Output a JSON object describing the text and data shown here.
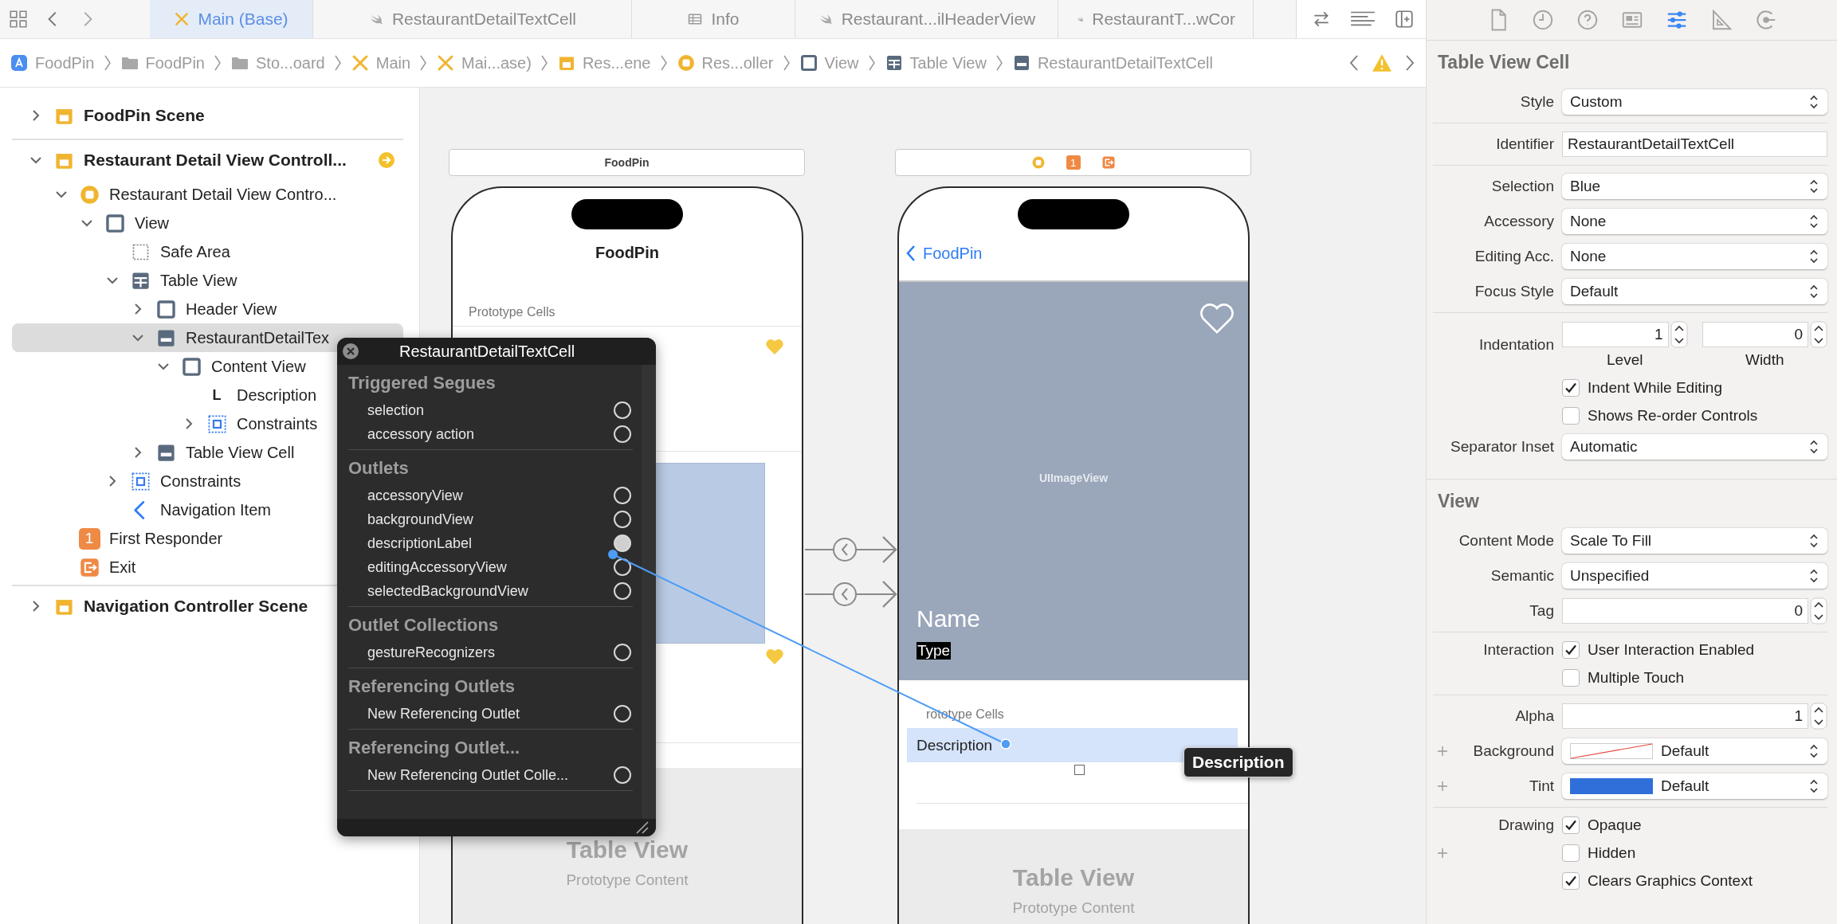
{
  "tab_bar": {
    "tabs": [
      {
        "label": "Main (Base)",
        "kind": "storyboard",
        "selected": true
      },
      {
        "label": "RestaurantDetailTextCell",
        "kind": "swift",
        "selected": false
      },
      {
        "label": "Info",
        "kind": "plist",
        "selected": false
      },
      {
        "label": "Restaurant...ilHeaderView",
        "kind": "swift",
        "selected": false
      },
      {
        "label": "RestaurantT...wCor",
        "kind": "swift",
        "selected": false
      }
    ]
  },
  "jump_bar": [
    {
      "label": "FoodPin",
      "kind": "app"
    },
    {
      "label": "FoodPin",
      "kind": "folder"
    },
    {
      "label": "Sto...oard",
      "kind": "folder"
    },
    {
      "label": "Main",
      "kind": "storyboard"
    },
    {
      "label": "Mai...ase)",
      "kind": "storyboard"
    },
    {
      "label": "Res...ene",
      "kind": "scene"
    },
    {
      "label": "Res...oller",
      "kind": "controller"
    },
    {
      "label": "View",
      "kind": "view"
    },
    {
      "label": "Table View",
      "kind": "table"
    },
    {
      "label": "RestaurantDetailTextCell",
      "kind": "cell"
    }
  ],
  "outline": {
    "scenes": [
      {
        "label": "FoodPin Scene",
        "expanded": false,
        "selected": false,
        "entry_arrow": false
      },
      {
        "label": "Restaurant Detail View Controll...",
        "expanded": true,
        "selected": false,
        "entry_arrow": true,
        "children": [
          {
            "label": "Restaurant Detail View Contro...",
            "kind": "controller",
            "expanded": true,
            "selected": false,
            "children": [
              {
                "label": "View",
                "kind": "view",
                "expanded": true,
                "selected": false,
                "children": [
                  {
                    "label": "Safe Area",
                    "kind": "safe-area",
                    "selected": false
                  },
                  {
                    "label": "Table View",
                    "kind": "table",
                    "expanded": true,
                    "selected": false,
                    "children": [
                      {
                        "label": "Header View",
                        "kind": "view",
                        "expanded": false,
                        "selected": false
                      },
                      {
                        "label": "RestaurantDetailTex",
                        "kind": "cell",
                        "expanded": true,
                        "selected": true,
                        "children": [
                          {
                            "label": "Content View",
                            "kind": "view",
                            "expanded": true,
                            "selected": false,
                            "children": [
                              {
                                "label": "Description",
                                "kind": "label",
                                "glyph": "L",
                                "selected": false
                              },
                              {
                                "label": "Constraints",
                                "kind": "constraints",
                                "expanded": false,
                                "selected": false
                              }
                            ]
                          }
                        ]
                      },
                      {
                        "label": "Table View Cell",
                        "kind": "cell",
                        "expanded": false,
                        "selected": false
                      }
                    ]
                  },
                  {
                    "label": "Constraints",
                    "kind": "constraints",
                    "expanded": false,
                    "selected": false
                  },
                  {
                    "label": "Navigation Item",
                    "kind": "nav-item",
                    "selected": false
                  }
                ]
              }
            ]
          },
          {
            "label": "First Responder",
            "kind": "first-responder",
            "glyph": "1",
            "selected": false
          },
          {
            "label": "Exit",
            "kind": "exit",
            "selected": false
          }
        ]
      },
      {
        "label": "Navigation Controller Scene",
        "expanded": false,
        "selected": false,
        "entry_arrow": false
      }
    ]
  },
  "connections_popup": {
    "title": "RestaurantDetailTextCell",
    "sections": [
      {
        "title": "Triggered Segues",
        "items": [
          {
            "label": "selection",
            "connected": false
          },
          {
            "label": "accessory action",
            "connected": false
          }
        ]
      },
      {
        "title": "Outlets",
        "items": [
          {
            "label": "accessoryView",
            "connected": false
          },
          {
            "label": "backgroundView",
            "connected": false
          },
          {
            "label": "descriptionLabel",
            "connected": true
          },
          {
            "label": "editingAccessoryView",
            "connected": false
          },
          {
            "label": "selectedBackgroundView",
            "connected": false
          }
        ]
      },
      {
        "title": "Outlet Collections",
        "items": [
          {
            "label": "gestureRecognizers",
            "connected": false
          }
        ]
      },
      {
        "title": "Referencing Outlets",
        "items": [
          {
            "label": "New Referencing Outlet",
            "connected": false
          }
        ]
      },
      {
        "title": "Referencing Outlet...",
        "items": [
          {
            "label": "New Referencing Outlet Colle...",
            "connected": false
          }
        ]
      }
    ]
  },
  "canvas": {
    "scenes": [
      {
        "kind": "list",
        "bar_title": "FoodPin",
        "nav_title": "FoodPin",
        "section_header": "Prototype Cells",
        "table_title": "Table View",
        "table_subtitle": "Prototype Content"
      },
      {
        "kind": "detail",
        "bar_icons": [
          {
            "kind": "controller"
          },
          {
            "kind": "first-responder",
            "glyph": "1"
          },
          {
            "kind": "exit"
          }
        ],
        "back_label": "FoodPin",
        "image_label": "UIImageView",
        "name": "Name",
        "type": "Type",
        "section_header": "rototype Cells",
        "cell_label": "Description",
        "cell_selected": true,
        "table_title": "Table View",
        "table_subtitle": "Prototype Content"
      }
    ],
    "segues": [
      {
        "kind": "show"
      },
      {
        "kind": "show"
      }
    ],
    "tooltip": "Description"
  },
  "inspector": {
    "tabs": [
      {
        "kind": "file",
        "selected": false
      },
      {
        "kind": "clock",
        "selected": false
      },
      {
        "kind": "help",
        "selected": false
      },
      {
        "kind": "idcard",
        "selected": false
      },
      {
        "kind": "sliders",
        "selected": true
      },
      {
        "kind": "ruler",
        "selected": false
      },
      {
        "kind": "connections",
        "selected": false
      }
    ],
    "sections": [
      {
        "title": "Table View Cell",
        "groups": [
          [
            {
              "kind": "popup",
              "label": "Style",
              "value": "Custom"
            }
          ],
          [
            {
              "kind": "field",
              "label": "Identifier",
              "value": "RestaurantDetailTextCell"
            }
          ],
          [
            {
              "kind": "popup",
              "label": "Selection",
              "value": "Blue"
            },
            {
              "kind": "popup",
              "label": "Accessory",
              "value": "None"
            },
            {
              "kind": "popup",
              "label": "Editing Acc.",
              "value": "None"
            },
            {
              "kind": "popup",
              "label": "Focus Style",
              "value": "Default"
            }
          ],
          [
            {
              "kind": "pair",
              "label": "Indentation",
              "fields": [
                {
                  "value": "1",
                  "caption": "Level"
                },
                {
                  "value": "0",
                  "caption": "Width"
                }
              ]
            },
            {
              "kind": "checkbox",
              "text": "Indent While Editing",
              "checked": true
            },
            {
              "kind": "checkbox",
              "text": "Shows Re-order Controls",
              "checked": false
            },
            {
              "kind": "popup",
              "label": "Separator Inset",
              "value": "Automatic"
            }
          ]
        ]
      },
      {
        "title": "View",
        "groups": [
          [
            {
              "kind": "popup",
              "label": "Content Mode",
              "value": "Scale To Fill"
            },
            {
              "kind": "popup",
              "label": "Semantic",
              "value": "Unspecified"
            },
            {
              "kind": "number",
              "label": "Tag",
              "value": "0"
            }
          ],
          [
            {
              "kind": "checkbox",
              "label": "Interaction",
              "text": "User Interaction Enabled",
              "checked": true
            },
            {
              "kind": "checkbox",
              "text": "Multiple Touch",
              "checked": false
            }
          ],
          [
            {
              "kind": "number",
              "label": "Alpha",
              "value": "1"
            },
            {
              "kind": "color",
              "label": "Background",
              "value": "Default",
              "variations": true
            },
            {
              "kind": "color",
              "label": "Tint",
              "value": "Default",
              "color": "#2f6fd9",
              "variations": true
            }
          ],
          [
            {
              "kind": "checkbox",
              "label": "Drawing",
              "text": "Opaque",
              "checked": true
            },
            {
              "kind": "checkbox",
              "text": "Hidden",
              "checked": false,
              "variations": true
            },
            {
              "kind": "checkbox",
              "text": "Clears Graphics Context",
              "checked": true
            }
          ]
        ]
      }
    ]
  }
}
